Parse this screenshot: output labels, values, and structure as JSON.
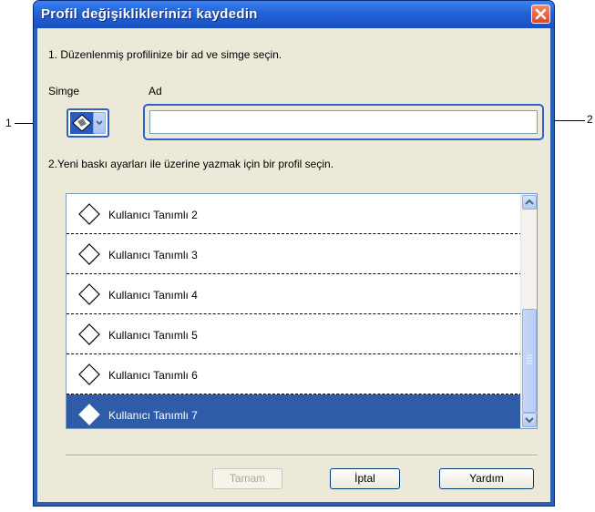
{
  "window": {
    "title": "Profil değişikliklerinizi kaydedin"
  },
  "step1": {
    "instruction": "1. Düzenlenmiş profilinize bir ad ve simge seçin.",
    "icon_label": "Simge",
    "name_label": "Ad",
    "name_value": "",
    "name_placeholder": ""
  },
  "step2": {
    "instruction": "2.Yeni baskı ayarları ile üzerine yazmak için bir profil seçin."
  },
  "callouts": {
    "left": "1",
    "right": "2"
  },
  "profiles": {
    "items": [
      {
        "label": "Kullanıcı Tanımlı 2",
        "selected": false
      },
      {
        "label": "Kullanıcı Tanımlı 3",
        "selected": false
      },
      {
        "label": "Kullanıcı Tanımlı 4",
        "selected": false
      },
      {
        "label": "Kullanıcı Tanımlı 5",
        "selected": false
      },
      {
        "label": "Kullanıcı Tanımlı 6",
        "selected": false
      },
      {
        "label": "Kullanıcı Tanımlı 7",
        "selected": true
      }
    ]
  },
  "buttons": {
    "ok": "Tamam",
    "cancel": "İptal",
    "help": "Yardım"
  },
  "colors": {
    "title_bar": "#2261d6",
    "selection": "#2f5ca8",
    "dialog_bg": "#ece9d8"
  },
  "icons": {
    "close": "close-icon",
    "profile": "diamond-icon",
    "dropdown": "chevron-down-icon",
    "scroll_up": "arrow-up-icon",
    "scroll_down": "arrow-down-icon"
  }
}
